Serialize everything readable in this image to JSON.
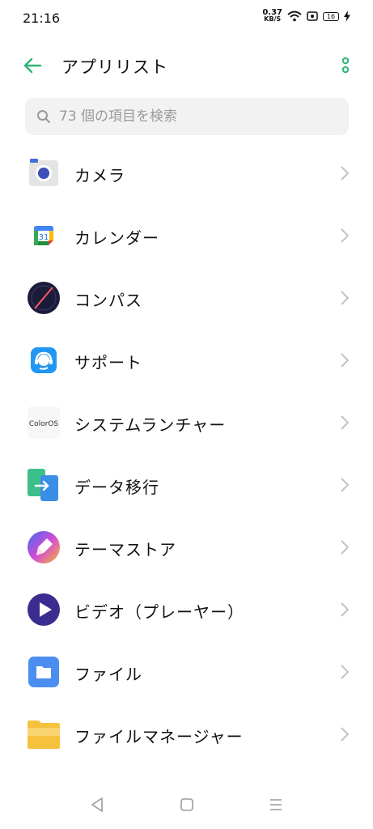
{
  "status": {
    "time": "21:16",
    "speed_value": "0.37",
    "speed_unit": "KB/S",
    "battery": "16"
  },
  "header": {
    "title": "アプリリスト"
  },
  "search": {
    "placeholder": "73 個の項目を検索"
  },
  "apps": [
    {
      "label": "カメラ",
      "icon": "camera-icon"
    },
    {
      "label": "カレンダー",
      "icon": "calendar-icon"
    },
    {
      "label": "コンパス",
      "icon": "compass-icon"
    },
    {
      "label": "サポート",
      "icon": "support-icon"
    },
    {
      "label": "システムランチャー",
      "icon": "coloros-launcher-icon",
      "icon_text": "ColorOS"
    },
    {
      "label": "データ移行",
      "icon": "data-migration-icon"
    },
    {
      "label": "テーマストア",
      "icon": "theme-store-icon"
    },
    {
      "label": "ビデオ（プレーヤー）",
      "icon": "video-player-icon"
    },
    {
      "label": "ファイル",
      "icon": "files-icon"
    },
    {
      "label": "ファイルマネージャー",
      "icon": "file-manager-icon"
    }
  ],
  "colors": {
    "accent": "#2bb673",
    "chevron": "#c2c2c2"
  }
}
